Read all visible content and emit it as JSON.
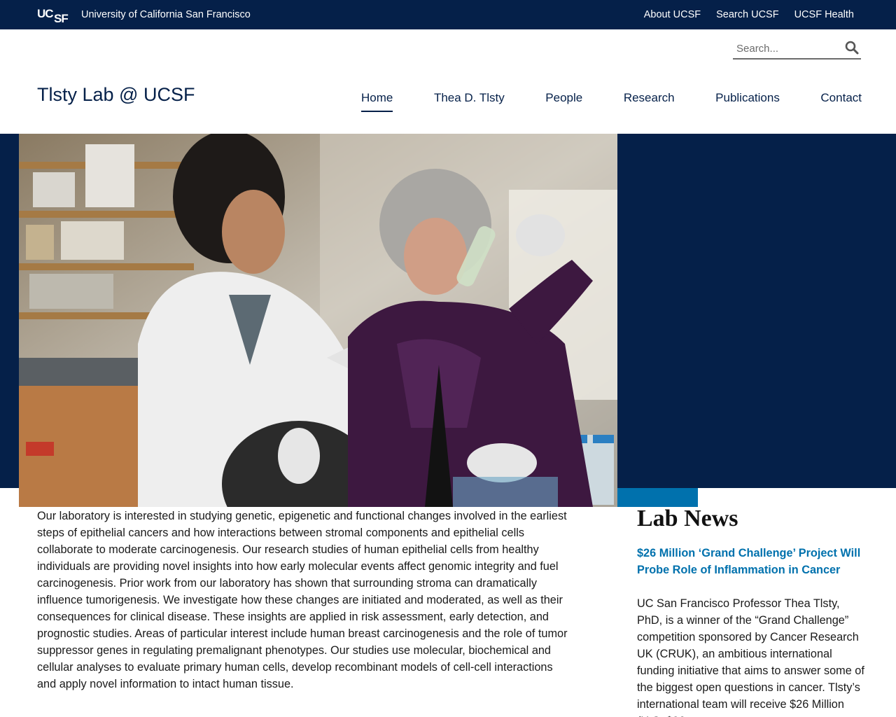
{
  "topbar": {
    "logo_text": "UCSF",
    "university_name": "University of California San Francisco",
    "links": [
      "About UCSF",
      "Search UCSF",
      "UCSF Health"
    ]
  },
  "header": {
    "search_placeholder": "Search...",
    "site_title": "Tlsty Lab @ UCSF",
    "nav": [
      "Home",
      "Thea D. Tlsty",
      "People",
      "Research",
      "Publications",
      "Contact"
    ],
    "active_nav": "Home",
    "search_icon": "magnifier-icon"
  },
  "hero": {
    "image_icon": "lab-photo"
  },
  "intro": {
    "text": "Our laboratory is interested in studying genetic, epigenetic and functional changes involved in the earliest steps of epithelial cancers and how interactions between stromal components and epithelial cells collaborate to moderate carcinogenesis. Our research studies of human epithelial cells from healthy individuals are providing novel insights into how early molecular events affect genomic integrity and fuel carcinogenesis. Prior work from our laboratory has shown that surrounding stroma can dramatically influence tumorigenesis. We investigate how these changes are initiated and moderated, as well as their consequences for clinical disease. These insights are applied in risk assessment, early detection, and prognostic studies. Areas of particular interest include human breast carcinogenesis and the role of tumor suppressor genes in regulating premalignant phenotypes. Our studies use molecular, biochemical and cellular analyses to evaluate primary human cells, develop recombinant models of cell-cell interactions and apply novel information to intact human tissue."
  },
  "news": {
    "heading": "Lab News",
    "title": "$26 Million ‘Grand Challenge’ Project Will Probe Role of Inflammation in Cancer",
    "body": "UC San Francisco Professor Thea Tlsty, PhD, is a winner of the “Grand Challenge” competition sponsored by Cancer Research UK (CRUK), an ambitious international funding initiative that aims to answer some of the biggest open questions in cancer. Tlsty’s international team will receive $26 Million (U.S. $26"
  },
  "colors": {
    "navy": "#052049",
    "accent_blue": "#0071ad"
  }
}
